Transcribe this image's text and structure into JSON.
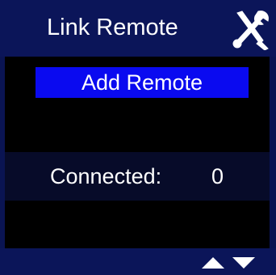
{
  "header": {
    "title": "Link Remote",
    "settings_icon": "wrench-screwdriver-icon"
  },
  "menu": {
    "add_remote_label": "Add Remote"
  },
  "status": {
    "connected_label": "Connected:",
    "connected_count": "0"
  },
  "footer": {
    "up_icon": "arrow-up-icon",
    "down_icon": "arrow-down-icon"
  },
  "colors": {
    "header_bg": "#0b1559",
    "selected_item_bg": "#0a0af0",
    "body_bg": "#000000",
    "text": "#ffffff"
  }
}
